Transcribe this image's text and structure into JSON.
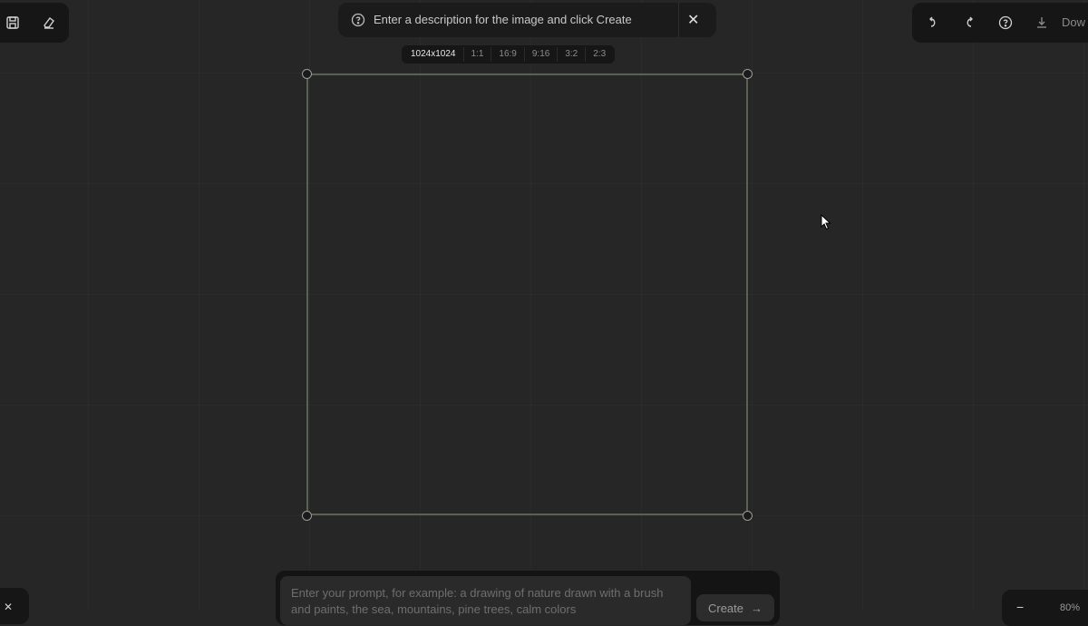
{
  "toolbar_left": {
    "icons": [
      "save-icon",
      "eraser-icon"
    ]
  },
  "hint": {
    "text": "Enter a description for the image and click Create",
    "close": "✕"
  },
  "size_chips": [
    {
      "label": "1024x1024",
      "active": true
    },
    {
      "label": "1:1",
      "active": false
    },
    {
      "label": "16:9",
      "active": false
    },
    {
      "label": "9:16",
      "active": false
    },
    {
      "label": "3:2",
      "active": false
    },
    {
      "label": "2:3",
      "active": false
    }
  ],
  "toolbar_right": {
    "download_label": "Dow"
  },
  "prompt": {
    "placeholder": "Enter your prompt, for example: a drawing of nature drawn with a brush and paints, the sea, mountains, pine trees, calm colors",
    "create_label": "Create",
    "create_arrow": "→"
  },
  "bottom_left": {
    "label": "✕"
  },
  "zoom": {
    "minus": "−",
    "value": "80%"
  },
  "colors": {
    "background": "#262626",
    "panel": "#161616",
    "frame_border": "#5a6350"
  }
}
